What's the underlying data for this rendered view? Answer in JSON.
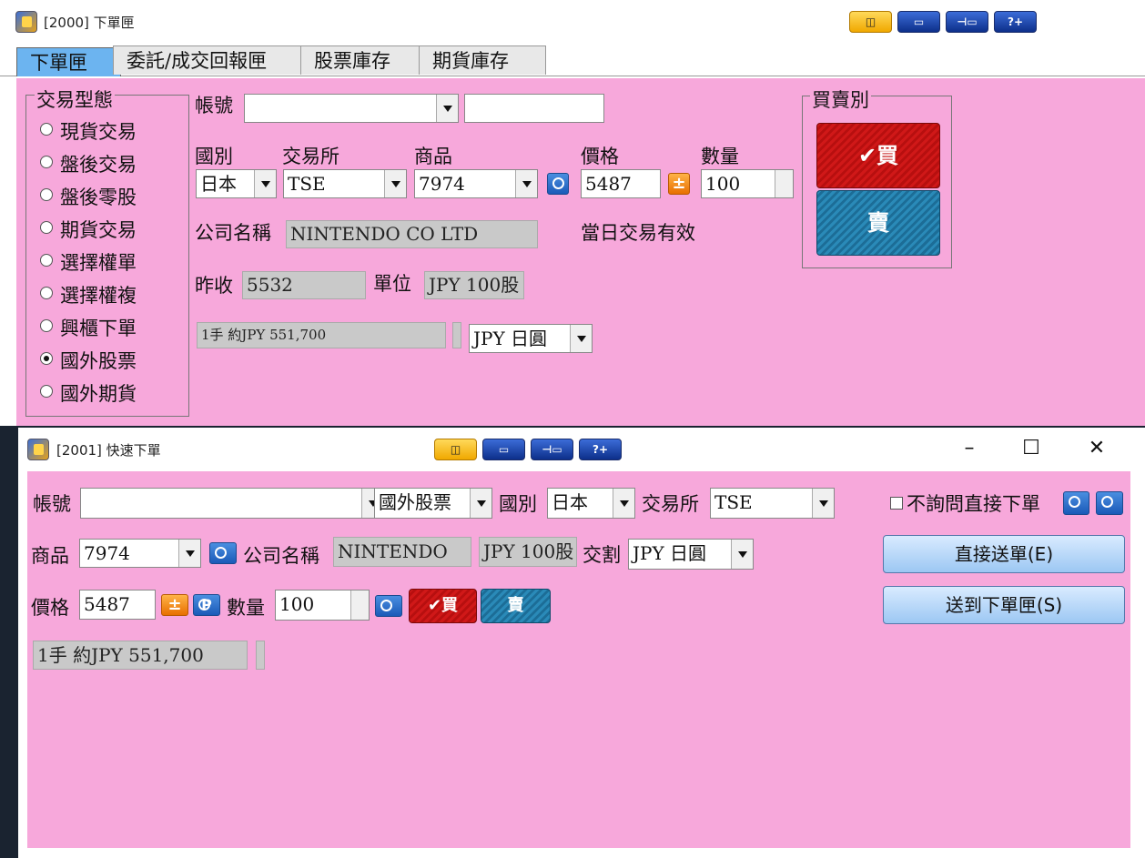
{
  "window1": {
    "title": "[2000] 下單匣",
    "toolbar": [
      "◫",
      "▭",
      "⊣▭",
      "?+"
    ],
    "tabs": [
      "下單匣",
      "委託/成交回報匣",
      "股票庫存",
      "期貨庫存"
    ],
    "trade_type_group": "交易型態",
    "trade_types": [
      "現貨交易",
      "盤後交易",
      "盤後零股",
      "期貨交易",
      "選擇權單",
      "選擇權複",
      "興櫃下單",
      "國外股票",
      "國外期貨"
    ],
    "account_label": "帳號",
    "account_value": "",
    "account_extra": "",
    "country_label": "國別",
    "country_value": "日本",
    "exchange_label": "交易所",
    "exchange_value": "TSE",
    "product_label": "商品",
    "product_value": "7974",
    "price_label": "價格",
    "price_value": "5487",
    "qty_label": "數量",
    "qty_value": "100",
    "company_label": "公司名稱",
    "company_value": "NINTENDO CO LTD",
    "validity": "當日交易有效",
    "prev_close_label": "昨收",
    "prev_close_value": "5532",
    "unit_label": "單位",
    "unit_value": "JPY 100股",
    "estimate": "1手 約JPY 551,700",
    "currency_value": "JPY 日圓",
    "side_group": "買賣別",
    "buy_label": "✔買",
    "sell_label": "賣",
    "pm_icon": "±"
  },
  "window2": {
    "title": "[2001] 快速下單",
    "toolbar": [
      "◫",
      "▭",
      "⊣▭",
      "?+"
    ],
    "win_controls": [
      "–",
      "☐",
      "✕"
    ],
    "account_label": "帳號",
    "account_value": "",
    "market_value": "國外股票",
    "country_label": "國別",
    "country_value": "日本",
    "exchange_label": "交易所",
    "exchange_value": "TSE",
    "no_confirm_label": "不詢問直接下單",
    "product_label": "商品",
    "product_value": "7974",
    "company_label": "公司名稱",
    "company_value": "NINTENDO",
    "unit_value": "JPY 100股",
    "settle_label": "交割",
    "settle_value": "JPY 日圓",
    "direct_send": "直接送單(E)",
    "price_label": "價格",
    "price_value": "5487",
    "qty_label": "數量",
    "qty_value": "100",
    "buy_label": "✔買",
    "sell_label": "賣",
    "send_to_box": "送到下單匣(S)",
    "estimate": "1手 約JPY 551,700",
    "pm_icon": "±",
    "p_icon": "P"
  }
}
